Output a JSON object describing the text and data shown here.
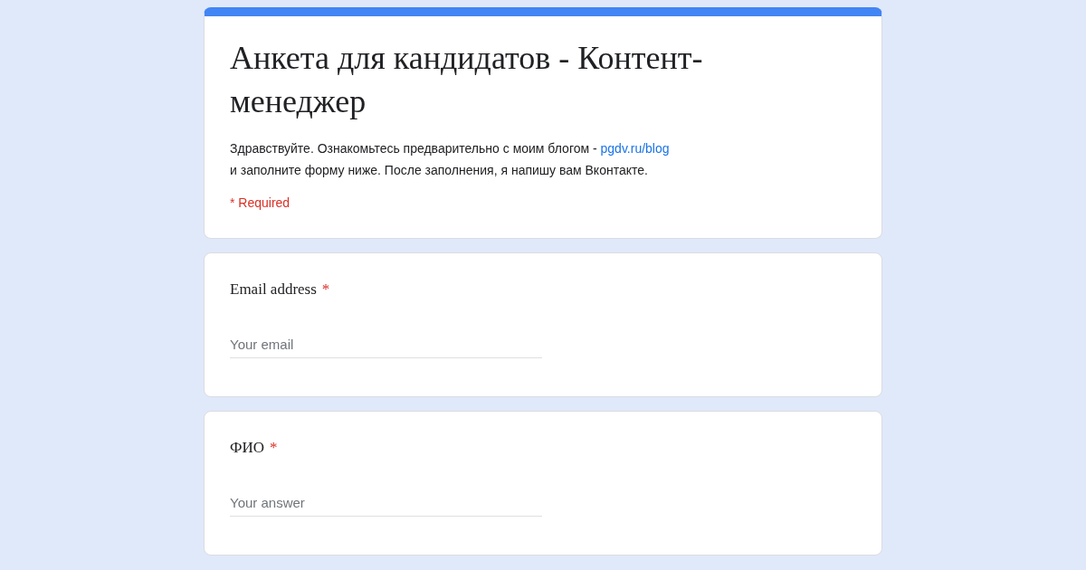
{
  "form": {
    "title": "Анкета для кандидатов - Контент-менеджер",
    "description": {
      "text": "Здравствуйте. Ознакомьтесь предварительно с моим блогом - ",
      "link": "pgdv.ru/blog",
      "text_after": "и заполните форму ниже. После заполнения, я напишу вам Вконтакте."
    },
    "required_note": "* Required"
  },
  "questions": [
    {
      "label": "Email address",
      "required": true,
      "required_mark": "*",
      "placeholder": "Your email"
    },
    {
      "label": "ФИО",
      "required": true,
      "required_mark": "*",
      "placeholder": "Your answer"
    }
  ]
}
